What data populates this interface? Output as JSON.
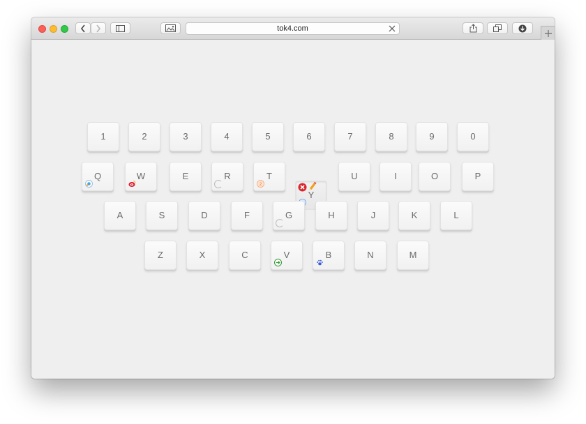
{
  "browser": {
    "url": "tok4.com"
  },
  "keyboard": {
    "row1": [
      "1",
      "2",
      "3",
      "4",
      "5",
      "6",
      "7",
      "8",
      "9",
      "0"
    ],
    "row2": [
      "Q",
      "W",
      "E",
      "R",
      "T",
      "Y",
      "U",
      "I",
      "O",
      "P"
    ],
    "row3": [
      "A",
      "S",
      "D",
      "F",
      "G",
      "H",
      "J",
      "K",
      "L"
    ],
    "row4": [
      "Z",
      "X",
      "C",
      "V",
      "B",
      "N",
      "M"
    ]
  },
  "icons": {
    "back": "chevron-left-icon",
    "forward": "chevron-right-icon",
    "sidebar": "sidebar-icon",
    "reader": "image-icon",
    "clear": "close-icon",
    "share": "share-icon",
    "tabs": "tabs-icon",
    "downloads": "download-icon",
    "new_tab": "plus-icon"
  },
  "colors": {
    "close_light": "#fc5f57",
    "minimize_light": "#fdbc2e",
    "zoom_light": "#33c748"
  }
}
